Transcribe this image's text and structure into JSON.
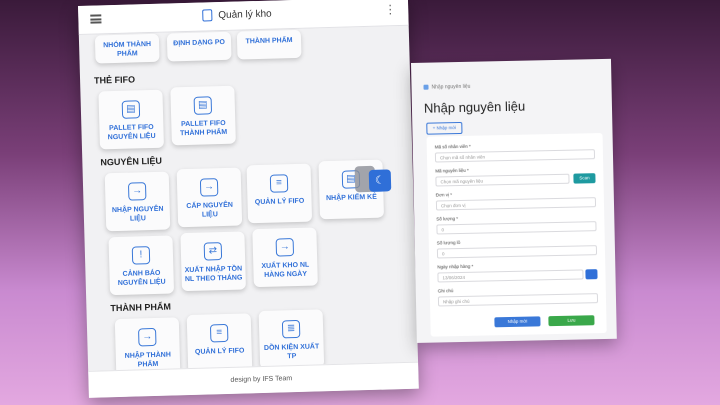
{
  "app": {
    "title": "Quản lý kho",
    "footer": "design by  IFS Team"
  },
  "top_row": [
    "NHÓM THÀNH PHẨM",
    "ĐỊNH DẠNG PO",
    "THÀNH PHẨM"
  ],
  "sections": [
    {
      "title": "THẺ FIFO",
      "tiles": [
        {
          "label": "PALLET FIFO NGUYÊN LIỆU",
          "icon": "file-icon"
        },
        {
          "label": "PALLET FIFO THÀNH PHẨM",
          "icon": "file-icon"
        }
      ]
    },
    {
      "title": "NGUYÊN LIỆU",
      "tiles": [
        {
          "label": "NHẬP NGUYÊN LIỆU",
          "icon": "login-icon"
        },
        {
          "label": "CẤP NGUYÊN LIỆU",
          "icon": "logout-icon"
        },
        {
          "label": "QUẢN LÝ FIFO",
          "icon": "list-icon"
        },
        {
          "label": "NHẬP KIỂM KÊ",
          "icon": "file-icon"
        },
        {
          "label": "CẢNH BÁO NGUYÊN LIỆU",
          "icon": "warning-icon"
        },
        {
          "label": "XUẤT NHẬP TỒN NL THEO THÁNG",
          "icon": "swap-icon"
        },
        {
          "label": "XUẤT KHO NL HÀNG NGÀY",
          "icon": "logout-icon"
        }
      ]
    },
    {
      "title": "THÀNH PHẨM",
      "tiles": [
        {
          "label": "NHẬP THÀNH PHẨM",
          "icon": "login-icon"
        },
        {
          "label": "QUẢN LÝ FIFO",
          "icon": "list-icon"
        },
        {
          "label": "DỒN KIỆN XUẤT TP",
          "icon": "database-icon"
        }
      ]
    }
  ],
  "form_card": {
    "breadcrumb": "Nhập nguyên liệu",
    "title": "Nhập nguyên liệu",
    "add_button": "+ Nhập mới",
    "fields": [
      {
        "label": "Mã số nhân viên *",
        "placeholder": "Chọn mã số nhân viên"
      },
      {
        "label": "Mã nguyên liệu *",
        "placeholder": "Chọn mã nguyên liệu"
      },
      {
        "label": "Đơn vị *",
        "placeholder": "Chọn đơn vị"
      },
      {
        "label": "Số lượng *",
        "placeholder": "0"
      },
      {
        "label": "Số lượng lô",
        "placeholder": "0"
      },
      {
        "label": "Ngày nhập hàng *",
        "placeholder": "13/06/2024"
      },
      {
        "label": "Ghi chú",
        "placeholder": "Nhập ghi chú"
      }
    ],
    "scan_button": "Scan",
    "save_new_button": "Nhập mới",
    "save_button": "Lưu"
  }
}
